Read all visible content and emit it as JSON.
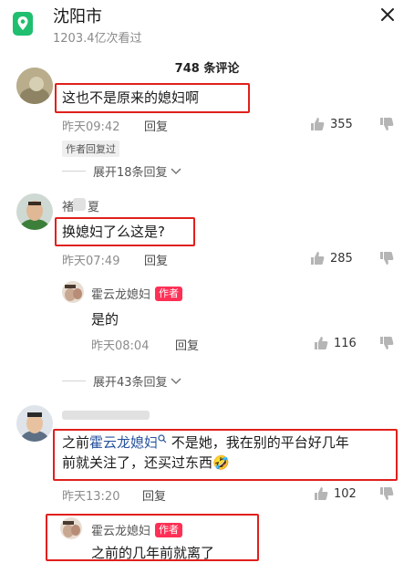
{
  "header": {
    "city": "沈阳市",
    "views": "1203.4亿次看过",
    "comment_count": "748 条评论"
  },
  "comments": [
    {
      "text": "这也不是原来的媳妇啊",
      "time": "昨天09:42",
      "reply": "回复",
      "likes": "355",
      "author_replied": "作者回复过",
      "expand": "展开18条回复"
    },
    {
      "name_partial": "褚",
      "name_suffix": "夏",
      "text": "换媳妇了么这是?",
      "time": "昨天07:49",
      "reply": "回复",
      "likes": "285",
      "sub": {
        "author": "霍云龙媳妇",
        "badge": "作者",
        "text": "是的",
        "time": "昨天08:04",
        "reply": "回复",
        "likes": "116"
      },
      "expand": "展开43条回复"
    },
    {
      "text_before": "之前",
      "mention": "霍云龙媳妇",
      "text_after_line1": " 不是她，我在别的平台好几年",
      "text_line2": "前就关注了，还买过东西",
      "emoji": "🤣",
      "time": "昨天13:20",
      "reply": "回复",
      "likes": "102",
      "sub": {
        "author": "霍云龙媳妇",
        "badge": "作者",
        "text": "之前的几年前就离了"
      }
    }
  ],
  "colors": {
    "accent_red": "#e0201c",
    "author_badge": "#ff2f55",
    "mention": "#26529d",
    "location_icon": "#1fbf6f"
  }
}
